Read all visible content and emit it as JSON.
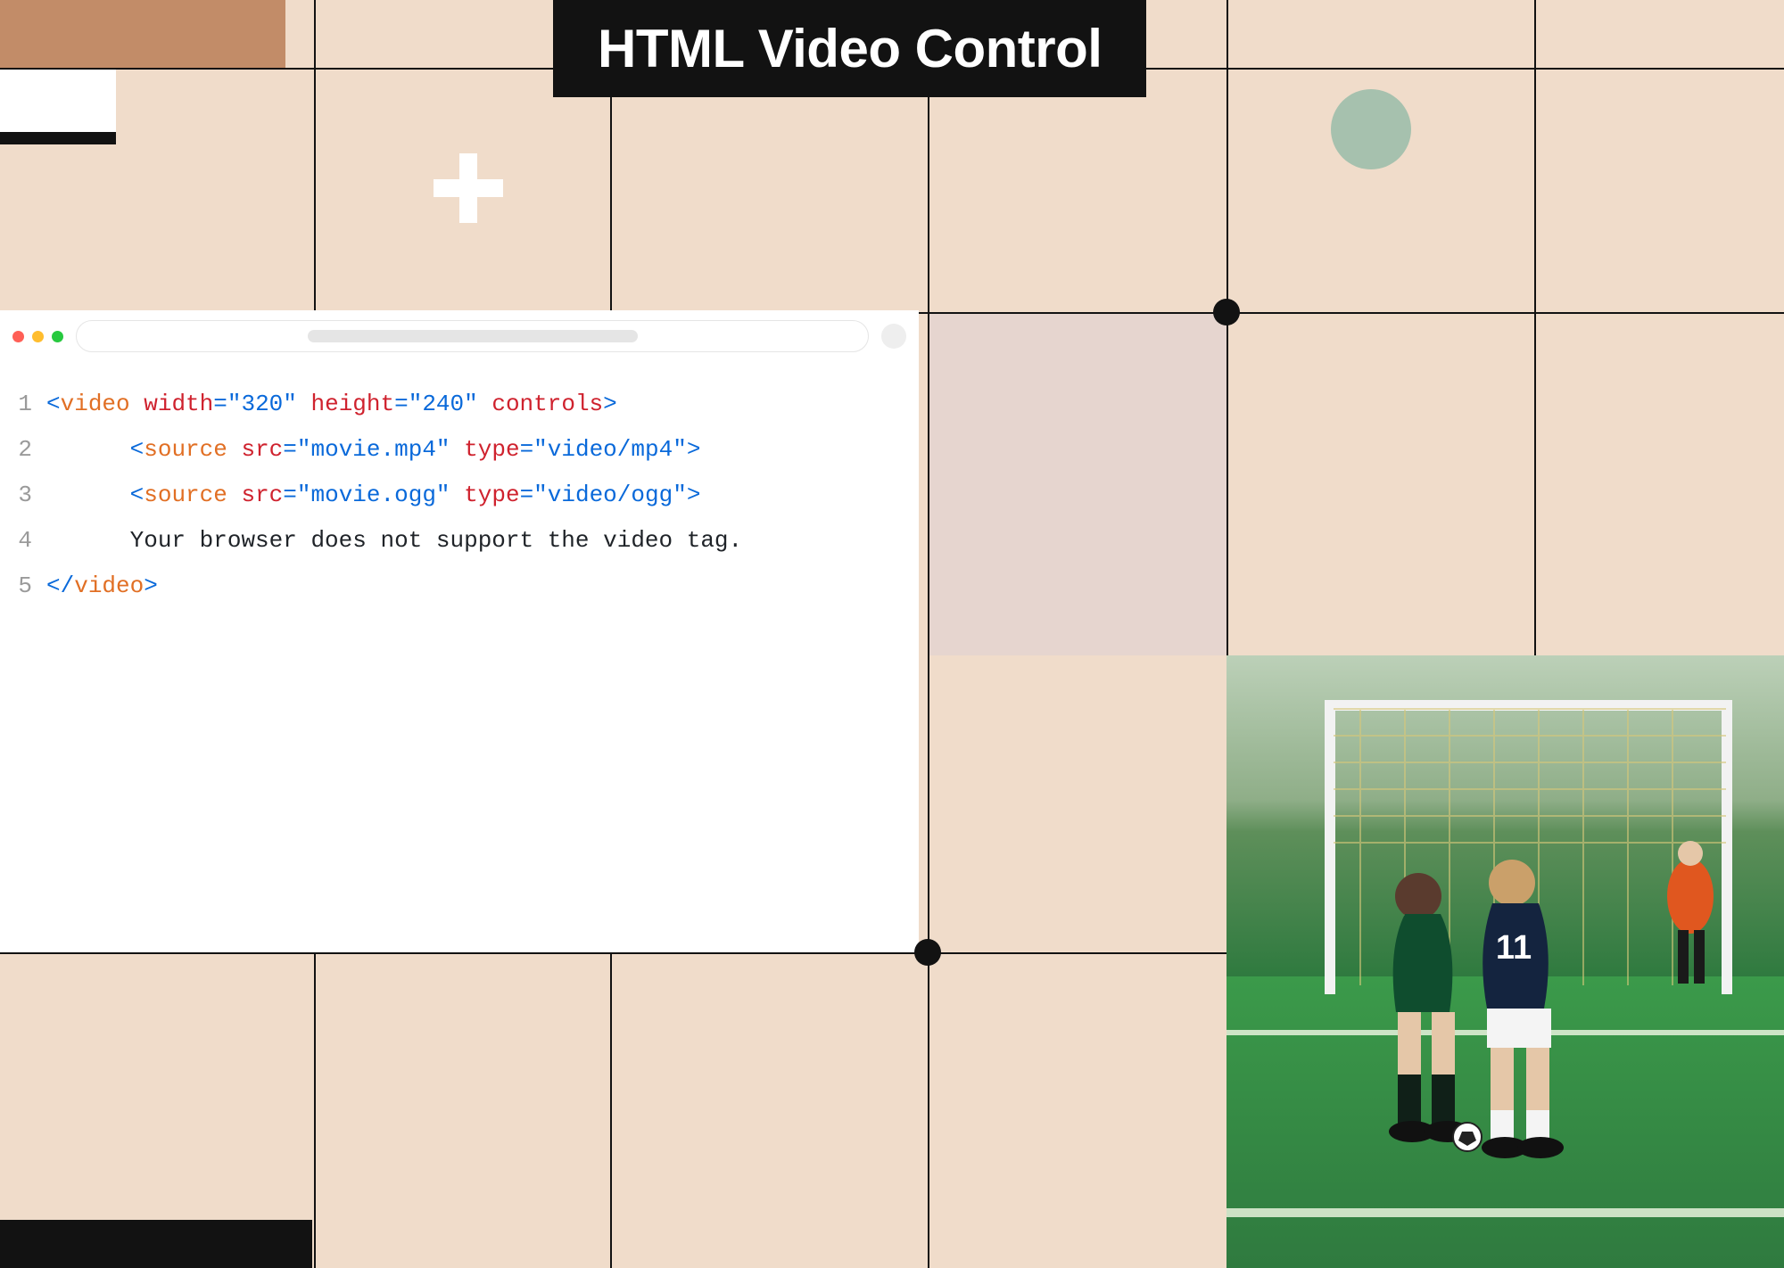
{
  "title": "HTML Video Control",
  "code_lines": [
    {
      "no": "1",
      "indent": "",
      "parts": [
        {
          "cls": "t-punct",
          "t": "<"
        },
        {
          "cls": "t-tag",
          "t": "video"
        },
        {
          "cls": "t-text",
          "t": " "
        },
        {
          "cls": "t-attr",
          "t": "width"
        },
        {
          "cls": "t-punct",
          "t": "="
        },
        {
          "cls": "t-val",
          "t": "\"320\""
        },
        {
          "cls": "t-text",
          "t": " "
        },
        {
          "cls": "t-attr",
          "t": "height"
        },
        {
          "cls": "t-punct",
          "t": "="
        },
        {
          "cls": "t-val",
          "t": "\"240\""
        },
        {
          "cls": "t-text",
          "t": " "
        },
        {
          "cls": "t-attr",
          "t": "controls"
        },
        {
          "cls": "t-punct",
          "t": ">"
        }
      ]
    },
    {
      "no": "2",
      "indent": "      ",
      "parts": [
        {
          "cls": "t-punct",
          "t": "<"
        },
        {
          "cls": "t-tag",
          "t": "source"
        },
        {
          "cls": "t-text",
          "t": " "
        },
        {
          "cls": "t-attr",
          "t": "src"
        },
        {
          "cls": "t-punct",
          "t": "="
        },
        {
          "cls": "t-val",
          "t": "\"movie.mp4\""
        },
        {
          "cls": "t-text",
          "t": " "
        },
        {
          "cls": "t-attr",
          "t": "type"
        },
        {
          "cls": "t-punct",
          "t": "="
        },
        {
          "cls": "t-val",
          "t": "\"video/mp4\""
        },
        {
          "cls": "t-punct",
          "t": ">"
        }
      ]
    },
    {
      "no": "3",
      "indent": "      ",
      "parts": [
        {
          "cls": "t-punct",
          "t": "<"
        },
        {
          "cls": "t-tag",
          "t": "source"
        },
        {
          "cls": "t-text",
          "t": " "
        },
        {
          "cls": "t-attr",
          "t": "src"
        },
        {
          "cls": "t-punct",
          "t": "="
        },
        {
          "cls": "t-val",
          "t": "\"movie.ogg\""
        },
        {
          "cls": "t-text",
          "t": " "
        },
        {
          "cls": "t-attr",
          "t": "type"
        },
        {
          "cls": "t-punct",
          "t": "="
        },
        {
          "cls": "t-val",
          "t": "\"video/ogg\""
        },
        {
          "cls": "t-punct",
          "t": ">"
        }
      ]
    },
    {
      "no": "4",
      "indent": "      ",
      "parts": [
        {
          "cls": "t-text",
          "t": "Your browser does not support the video tag."
        }
      ]
    },
    {
      "no": "5",
      "indent": "",
      "parts": [
        {
          "cls": "t-punct",
          "t": "</"
        },
        {
          "cls": "t-tag",
          "t": "video"
        },
        {
          "cls": "t-punct",
          "t": ">"
        }
      ]
    }
  ],
  "photo_alt": "Two soccer players competing on a field with a goal in the background"
}
